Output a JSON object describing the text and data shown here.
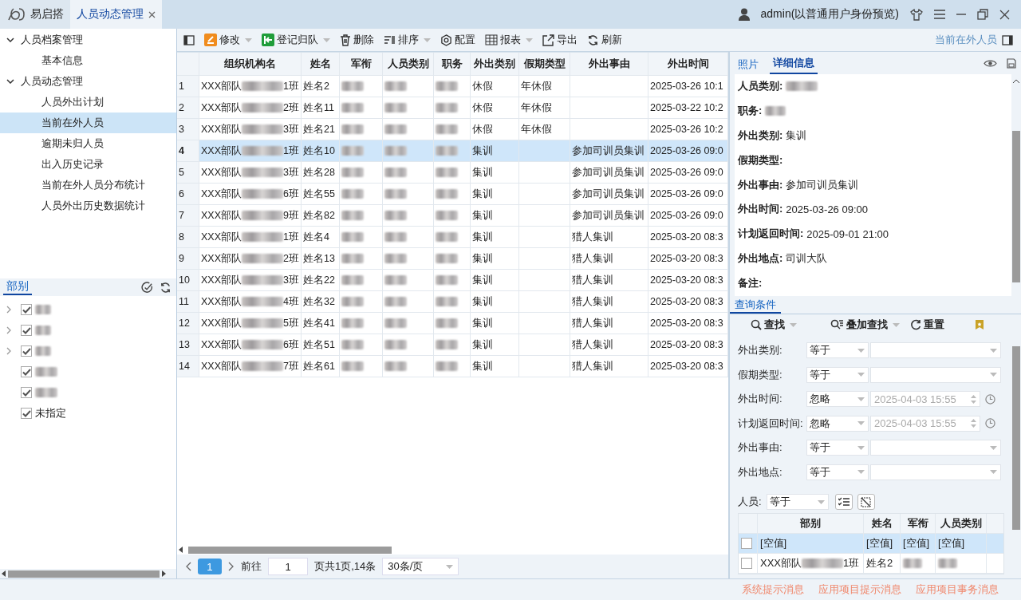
{
  "tabs": [
    {
      "label": "易启搭",
      "kind": "home",
      "selected": false
    },
    {
      "label": "人员动态管理",
      "kind": "page",
      "selected": true
    }
  ],
  "user": "admin(以普通用户身份预览)",
  "nav": [
    {
      "label": "人员档案管理",
      "expanded": true,
      "children": [
        {
          "label": "基本信息",
          "selected": false
        }
      ]
    },
    {
      "label": "人员动态管理",
      "expanded": true,
      "children": [
        {
          "label": "人员外出计划",
          "selected": false
        },
        {
          "label": "当前在外人员",
          "selected": true
        },
        {
          "label": "逾期未归人员",
          "selected": false
        },
        {
          "label": "出入历史记录",
          "selected": false
        },
        {
          "label": "当前在外人员分布统计",
          "selected": false
        },
        {
          "label": "人员外出历史数据统计",
          "selected": false
        }
      ]
    }
  ],
  "department_panel": {
    "title": "部别",
    "items": [
      {
        "blurred": true,
        "checked": true,
        "expandable": true
      },
      {
        "blurred": true,
        "checked": true,
        "expandable": true
      },
      {
        "blurred": true,
        "checked": true,
        "expandable": true
      },
      {
        "blurred": true,
        "checked": true,
        "expandable": false
      },
      {
        "blurred": true,
        "checked": true,
        "expandable": false
      },
      {
        "label": "未指定",
        "blurred": false,
        "checked": true,
        "expandable": false
      }
    ]
  },
  "toolbar": [
    {
      "label": "修改",
      "kind": "edit",
      "dropdown": true
    },
    {
      "label": "登记归队",
      "kind": "return",
      "dropdown": true
    },
    {
      "label": "删除",
      "kind": "delete",
      "dropdown": false
    },
    {
      "label": "排序",
      "kind": "sort",
      "dropdown": true
    },
    {
      "label": "配置",
      "kind": "config",
      "dropdown": false
    },
    {
      "label": "报表",
      "kind": "report",
      "dropdown": true
    },
    {
      "label": "导出",
      "kind": "export",
      "dropdown": false
    },
    {
      "label": "刷新",
      "kind": "refresh",
      "dropdown": false
    }
  ],
  "breadcrumb": "当前在外人员",
  "table": {
    "columns": [
      {
        "label": "组织机构名",
        "kind": "org"
      },
      {
        "label": "姓名",
        "kind": "text"
      },
      {
        "label": "军衔",
        "kind": "blurred"
      },
      {
        "label": "人员类别",
        "kind": "blurred"
      },
      {
        "label": "职务",
        "kind": "blurred"
      },
      {
        "label": "外出类别",
        "kind": "text"
      },
      {
        "label": "假期类型",
        "kind": "text"
      },
      {
        "label": "外出事由",
        "kind": "text"
      },
      {
        "label": "外出时间",
        "kind": "text"
      }
    ],
    "rows": [
      {
        "num": "1",
        "selected": false,
        "cells": [
          [
            "XXX部队",
            "1班"
          ],
          "姓名2",
          null,
          null,
          null,
          "休假",
          "年休假",
          null,
          "2025-03-26 10:1"
        ]
      },
      {
        "num": "2",
        "selected": false,
        "cells": [
          [
            "XXX部队",
            "2班"
          ],
          "姓名11",
          null,
          null,
          null,
          "休假",
          "年休假",
          null,
          "2025-03-22 10:2"
        ]
      },
      {
        "num": "3",
        "selected": false,
        "cells": [
          [
            "XXX部队",
            "3班"
          ],
          "姓名21",
          null,
          null,
          null,
          "休假",
          "年休假",
          null,
          "2025-03-26 10:2"
        ]
      },
      {
        "num": "4",
        "selected": true,
        "cells": [
          [
            "XXX部队",
            "1班"
          ],
          "姓名10",
          null,
          null,
          null,
          "集训",
          null,
          "参加司训员集训",
          "2025-03-26 09:0"
        ]
      },
      {
        "num": "5",
        "selected": false,
        "cells": [
          [
            "XXX部队",
            "3班"
          ],
          "姓名28",
          null,
          null,
          null,
          "集训",
          null,
          "参加司训员集训",
          "2025-03-26 09:0"
        ]
      },
      {
        "num": "6",
        "selected": false,
        "cells": [
          [
            "XXX部队",
            "6班"
          ],
          "姓名55",
          null,
          null,
          null,
          "集训",
          null,
          "参加司训员集训",
          "2025-03-26 09:0"
        ]
      },
      {
        "num": "7",
        "selected": false,
        "cells": [
          [
            "XXX部队",
            "9班"
          ],
          "姓名82",
          null,
          null,
          null,
          "集训",
          null,
          "参加司训员集训",
          "2025-03-26 09:0"
        ]
      },
      {
        "num": "8",
        "selected": false,
        "cells": [
          [
            "XXX部队",
            "1班"
          ],
          "姓名4",
          null,
          null,
          null,
          "集训",
          null,
          "猎人集训",
          "2025-03-20 08:3"
        ]
      },
      {
        "num": "9",
        "selected": false,
        "cells": [
          [
            "XXX部队",
            "2班"
          ],
          "姓名13",
          null,
          null,
          null,
          "集训",
          null,
          "猎人集训",
          "2025-03-20 08:3"
        ]
      },
      {
        "num": "10",
        "selected": false,
        "cells": [
          [
            "XXX部队",
            "3班"
          ],
          "姓名22",
          null,
          null,
          null,
          "集训",
          null,
          "猎人集训",
          "2025-03-20 08:3"
        ]
      },
      {
        "num": "11",
        "selected": false,
        "cells": [
          [
            "XXX部队",
            "4班"
          ],
          "姓名32",
          null,
          null,
          null,
          "集训",
          null,
          "猎人集训",
          "2025-03-20 08:3"
        ]
      },
      {
        "num": "12",
        "selected": false,
        "cells": [
          [
            "XXX部队",
            "5班"
          ],
          "姓名41",
          null,
          null,
          null,
          "集训",
          null,
          "猎人集训",
          "2025-03-20 08:3"
        ]
      },
      {
        "num": "13",
        "selected": false,
        "cells": [
          [
            "XXX部队",
            "6班"
          ],
          "姓名51",
          null,
          null,
          null,
          "集训",
          null,
          "猎人集训",
          "2025-03-20 08:3"
        ]
      },
      {
        "num": "14",
        "selected": false,
        "cells": [
          [
            "XXX部队",
            "7班"
          ],
          "姓名61",
          null,
          null,
          null,
          "集训",
          null,
          "猎人集训",
          "2025-03-20 08:3"
        ]
      }
    ]
  },
  "pager": {
    "current_page": "1",
    "goto_label": "前往",
    "goto_value": "1",
    "summary": "页共1页,14条",
    "page_size": "30条/页"
  },
  "detail_tabs": [
    {
      "label": "照片",
      "selected": false
    },
    {
      "label": "详细信息",
      "selected": true
    }
  ],
  "details": [
    {
      "label": "人员类别:",
      "blurred": true
    },
    {
      "label": "职务:",
      "blurred": true
    },
    {
      "label": "外出类别:",
      "blurred": false,
      "value": "集训"
    },
    {
      "label": "假期类型:",
      "blurred": false
    },
    {
      "label": "外出事由:",
      "blurred": false,
      "value": "参加司训员集训"
    },
    {
      "label": "外出时间:",
      "blurred": false,
      "value": "2025-03-26 09:00"
    },
    {
      "label": "计划返回时间:",
      "blurred": false,
      "value": "2025-09-01 21:00"
    },
    {
      "label": "外出地点:",
      "blurred": false,
      "value": "司训大队"
    },
    {
      "label": "备注:",
      "blurred": false
    }
  ],
  "query": {
    "title": "查询条件",
    "actions": [
      {
        "label": "查找",
        "kind": "search",
        "dropdown": true
      },
      {
        "label": "叠加查找",
        "kind": "stack",
        "dropdown": true
      },
      {
        "label": "重置",
        "kind": "reset",
        "dropdown": false
      }
    ],
    "conditions": [
      {
        "label": "外出类别:",
        "operator": "等于",
        "kind": "select"
      },
      {
        "label": "假期类型:",
        "operator": "等于",
        "kind": "select"
      },
      {
        "label": "外出时间:",
        "operator": "忽略",
        "kind": "datetime",
        "value": "2025-04-03 15:55",
        "disabled": true
      },
      {
        "label": "计划返回时间:",
        "operator": "忽略",
        "kind": "datetime",
        "value": "2025-04-03 15:55",
        "disabled": true
      },
      {
        "label": "外出事由:",
        "operator": "等于",
        "kind": "select"
      },
      {
        "label": "外出地点:",
        "operator": "等于",
        "kind": "select"
      }
    ],
    "person": {
      "label": "人员:",
      "operator": "等于"
    },
    "person_table": {
      "columns": [
        {
          "label": "部别",
          "kind": "org"
        },
        {
          "label": "姓名",
          "kind": "text"
        },
        {
          "label": "军衔",
          "kind": "blurred"
        },
        {
          "label": "人员类别",
          "kind": "blurred"
        }
      ],
      "rows": [
        {
          "selected": true,
          "checked": false,
          "cells": [
            "[空值]",
            "[空值]",
            "[空值]",
            "[空值]"
          ]
        },
        {
          "selected": false,
          "checked": false,
          "cells": [
            [
              "XXX部队",
              "1班"
            ],
            "姓名2",
            null,
            null
          ]
        }
      ]
    }
  },
  "status_bar": [
    "系统提示消息",
    "应用项目提示消息",
    "应用项目事务消息"
  ]
}
